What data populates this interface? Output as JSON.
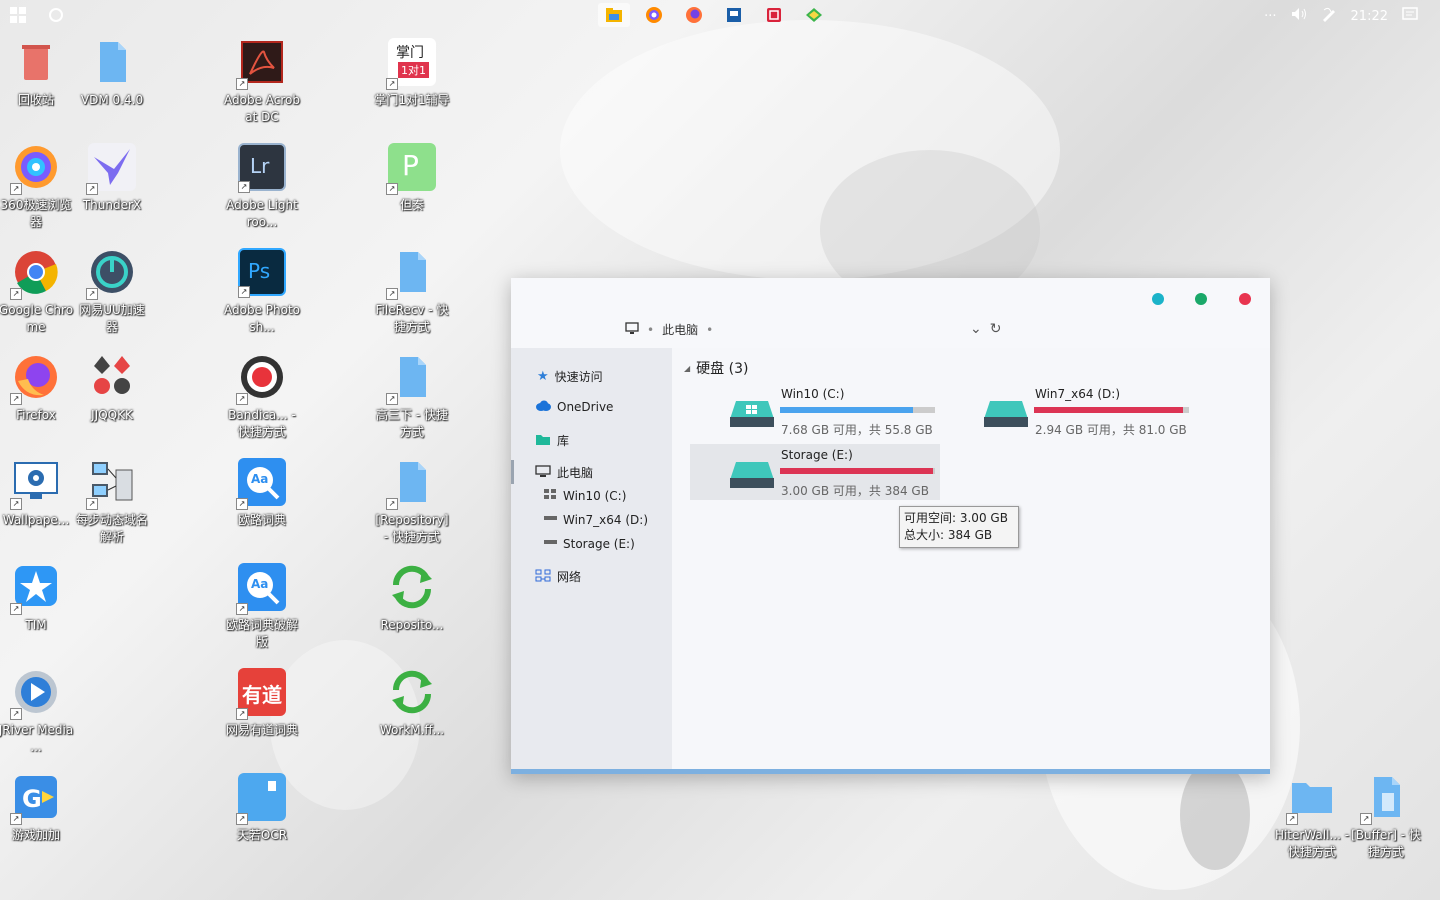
{
  "topbar": {
    "time": "21:22",
    "left_icons": [
      "windows-start-icon",
      "circle-search-icon"
    ],
    "tray_icons": [
      "more-dots-icon",
      "volume-icon",
      "pen-icon",
      "notification-icon"
    ],
    "tray_more": "···",
    "taskbar_apps": [
      "file-manager-icon",
      "360-browser-icon",
      "firefox-icon",
      "app-icon",
      "red-app-icon",
      "green-app-icon"
    ]
  },
  "desktop": {
    "icons": [
      {
        "label": "回收站"
      },
      {
        "label": "VDM 0.4.0"
      },
      {
        "label": "Adobe Acrobat DC"
      },
      {
        "label": "掌门1对1辅导"
      },
      {
        "label": "360极速浏览器"
      },
      {
        "label": "ThunderX"
      },
      {
        "label": "Adobe Lightroo..."
      },
      {
        "label": "但秦"
      },
      {
        "label": "Google Chrome"
      },
      {
        "label": "网易UU加速器"
      },
      {
        "label": "Adobe Photosh..."
      },
      {
        "label": "FileRecv - 快捷方式"
      },
      {
        "label": "Firefox"
      },
      {
        "label": "JJQQKK"
      },
      {
        "label": "Bandica... - 快捷方式"
      },
      {
        "label": "高三下 - 快捷方式"
      },
      {
        "label": "Wallpape..."
      },
      {
        "label": "每步动态域名解析"
      },
      {
        "label": "欧路词典"
      },
      {
        "label": "[Repository] - 快捷方式"
      },
      {
        "label": "TIM"
      },
      {
        "label": "欧路词典破解版"
      },
      {
        "label": "Reposito..."
      },
      {
        "label": "JRiver Media ..."
      },
      {
        "label": "网易有道词典"
      },
      {
        "label": "WorkM.ff..."
      },
      {
        "label": "游戏加加"
      },
      {
        "label": "天若OCR"
      },
      {
        "label": "HiterWall... - 快捷方式"
      },
      {
        "label": "[Buffer] - 快捷方式"
      }
    ],
    "icon_texts": {
      "zhangmen_top": "掌门",
      "zhangmen_badge": "1对1",
      "lr": "Lr",
      "ps": "Ps",
      "youdao": "有道",
      "dict": "Aa",
      "p": "P"
    }
  },
  "explorer": {
    "window_dots": {
      "colors": [
        "#1bb3c9",
        "#1aa869",
        "#e8344f"
      ]
    },
    "address": {
      "location": "此电脑",
      "sep": "•"
    },
    "address_controls": {
      "dropdown": "⌄",
      "refresh": "↻"
    },
    "sidebar": {
      "quick_access": "快速访问",
      "onedrive": "OneDrive",
      "library": "库",
      "this_pc": "此电脑",
      "drive_c": "Win10 (C:)",
      "drive_d": "Win7_x64 (D:)",
      "drive_e": "Storage (E:)",
      "network": "网络"
    },
    "section_title": "硬盘 (3)",
    "drives": [
      {
        "name": "Win10 (C:)",
        "info": "7.68 GB 可用，共 55.8 GB",
        "used_fraction": 0.86,
        "bar_color": "#4aa3ee"
      },
      {
        "name": "Win7_x64 (D:)",
        "info": "2.94 GB 可用，共 81.0 GB",
        "used_fraction": 0.96,
        "bar_color": "#dc3454"
      },
      {
        "name": "Storage (E:)",
        "info": "3.00 GB 可用，共 384 GB",
        "used_fraction": 0.99,
        "bar_color": "#dc3454"
      }
    ],
    "tooltip": {
      "free": "可用空间: 3.00 GB",
      "total": "总大小: 384 GB"
    }
  }
}
